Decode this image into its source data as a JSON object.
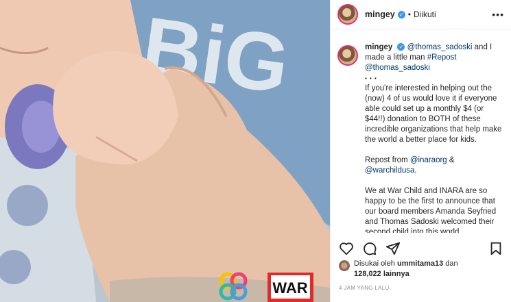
{
  "post": {
    "username": "mingey",
    "dot": "•",
    "follow_status": "Diikuti",
    "more": "• • •"
  },
  "caption": {
    "username": "mingey",
    "mention1": "@thomas_sadoski",
    "line1_rest": " and I made a little man ",
    "hashtag": "#Repost",
    "mention2": "@thomas_sadoski",
    "dots": "• • •",
    "para1": "If you're interested in helping out the (now) 4 of us would love it if everyone able could set up a monthly $4 (or $44!!) donation to BOTH of these incredible organizations that help make the world a better place for kids.",
    "para2_prefix": "Repost from ",
    "mention3": "@inaraorg",
    "para2_amp": " &",
    "mention4": "@warchildusa",
    "para2_suffix": ".",
    "para3": "We at War Child and INARA are so happy to be the first to announce that our board members Amanda Seyfried and Thomas Sadoski welcomed their second child into this world"
  },
  "likes": {
    "prefix": "Disukai oleh ",
    "user": "ummitama13",
    "connector": " dan",
    "count": "128,022",
    "suffix": " lainnya"
  },
  "time": "4 JAM YANG LALU",
  "photo": {
    "shirt_text": "BiG",
    "logo_text": "WAR"
  },
  "icons": [
    "heart-icon",
    "comment-icon",
    "share-icon",
    "bookmark-icon",
    "verified-icon"
  ]
}
